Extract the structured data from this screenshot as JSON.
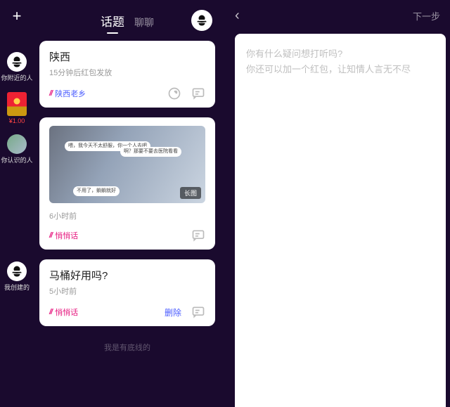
{
  "left": {
    "header": {
      "tab_active": "话题",
      "tab_inactive": "聊聊"
    },
    "rail": {
      "nearby_label": "你附近的人",
      "red_price": "¥1.00",
      "known_label": "你认识的人",
      "created_label": "我创建的"
    },
    "cards": [
      {
        "title": "陕西",
        "sub": "15分钟后红包发放",
        "tag": "陕西老乡",
        "tag_style": "blue",
        "has_share": true,
        "has_image": false
      },
      {
        "title": "",
        "sub": "6小时前",
        "tag": "悄悄话",
        "tag_style": "pink",
        "has_image": true,
        "image_badge": "长图",
        "bubble1": "喂，我今天不太舒服，你一个人去吧",
        "bubble2": "啊？那要不要去医院看看",
        "bubble3": "不用了，躺躺就好"
      },
      {
        "title": "马桶好用吗?",
        "sub": "5小时前",
        "tag": "悄悄话",
        "tag_style": "pink",
        "has_delete": true,
        "delete_label": "删除"
      }
    ],
    "footer": "我是有底线的"
  },
  "right": {
    "next": "下一步",
    "placeholder_l1": "你有什么疑问想打听吗?",
    "placeholder_l2": "你还可以加一个红包，让知情人言无不尽"
  }
}
